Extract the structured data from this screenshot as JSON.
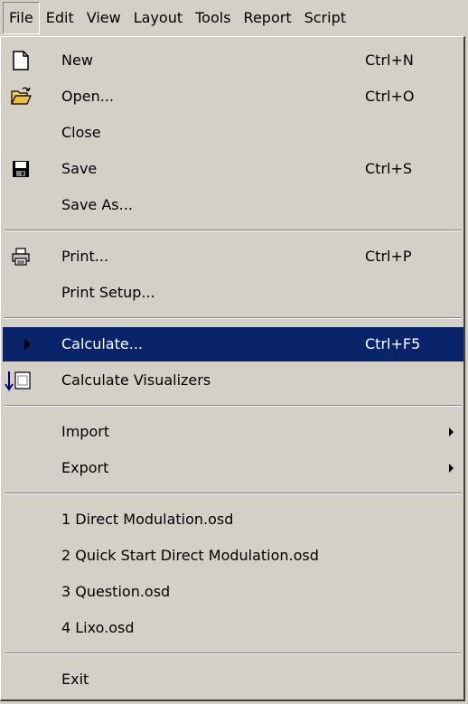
{
  "menubar": {
    "items": [
      "File",
      "Edit",
      "View",
      "Layout",
      "Tools",
      "Report",
      "Script"
    ]
  },
  "file_menu": {
    "new": {
      "label": "New",
      "shortcut": "Ctrl+N"
    },
    "open": {
      "label": "Open...",
      "shortcut": "Ctrl+O"
    },
    "close": {
      "label": "Close"
    },
    "save": {
      "label": "Save",
      "shortcut": "Ctrl+S"
    },
    "save_as": {
      "label": "Save As..."
    },
    "print": {
      "label": "Print...",
      "shortcut": "Ctrl+P"
    },
    "print_setup": {
      "label": "Print Setup..."
    },
    "calculate": {
      "label": "Calculate...",
      "shortcut": "Ctrl+F5"
    },
    "calculate_visualizers": {
      "label": "Calculate Visualizers"
    },
    "import": {
      "label": "Import"
    },
    "export": {
      "label": "Export"
    },
    "recent": [
      "1 Direct Modulation.osd",
      "2 Quick Start Direct Modulation.osd",
      "3 Question.osd",
      "4 Lixo.osd"
    ],
    "exit": {
      "label": "Exit"
    }
  },
  "colors": {
    "menu_face": "#d4d0c8",
    "highlight": "#0a246a",
    "highlight_text": "#ffffff"
  }
}
